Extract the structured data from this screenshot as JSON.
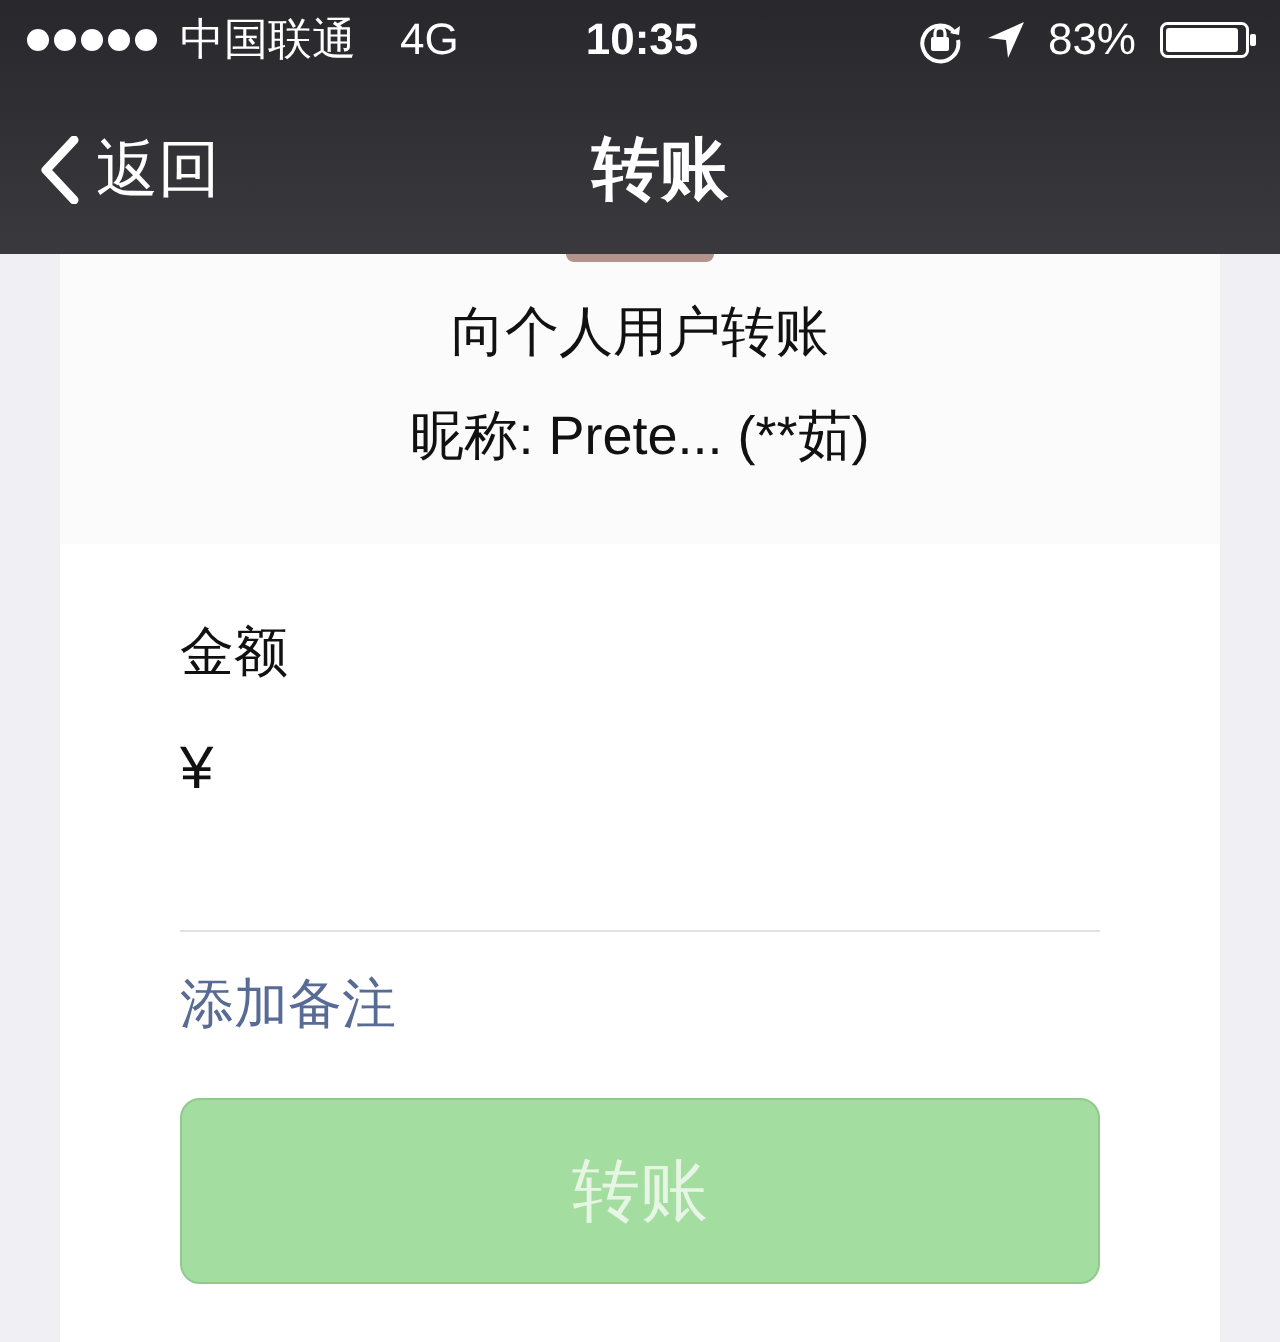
{
  "status_bar": {
    "carrier": "中国联通",
    "network": "4G",
    "time": "10:35",
    "battery": "83%"
  },
  "nav_bar": {
    "back": "返回",
    "title": "转账"
  },
  "recipient": {
    "heading": "向个人用户转账",
    "nickname": "昵称: Prete... (**茹)"
  },
  "amount": {
    "label": "金额",
    "currency": "¥"
  },
  "remark_link": "添加备注",
  "submit_button": {
    "label": "转账",
    "disabled": true
  }
}
